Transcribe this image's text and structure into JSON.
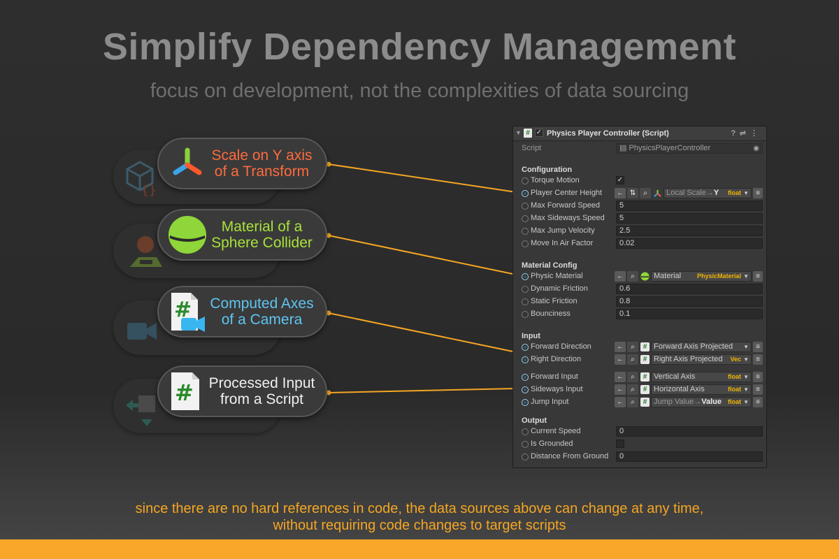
{
  "title": "Simplify Dependency Management",
  "subtitle": "focus on development, not the complexities of data sourcing",
  "footer": {
    "line1": "since there are no hard references in code, the data sources above can change at any time,",
    "line2": "without requiring code changes to target scripts"
  },
  "colors": {
    "accent": "#f9a72a",
    "transform_text": "#ff6b3d",
    "material_text": "#a8e23a",
    "camera_text": "#5fc4f0",
    "script_text": "#f0f0f0",
    "wire": "#f5a623"
  },
  "pills": [
    {
      "icon": "transform-axis-icon",
      "line1": "Scale on Y axis",
      "line2": "of a Transform"
    },
    {
      "icon": "sphere-material-icon",
      "line1": "Material of a",
      "line2": "Sphere Collider"
    },
    {
      "icon": "camera-script-icon",
      "line1": "Computed Axes",
      "line2": "of a Camera"
    },
    {
      "icon": "csharp-script-icon",
      "line1": "Processed Input",
      "line2": "from a Script"
    }
  ],
  "inspector": {
    "header_title": "Physics Player Controller (Script)",
    "script_label": "Script",
    "script_value": "PhysicsPlayerController",
    "sections": {
      "configuration": "Configuration",
      "material_config": "Material Config",
      "input": "Input",
      "output": "Output"
    },
    "config": {
      "torque_motion": "Torque Motion",
      "player_center_height": "Player Center Height",
      "player_center_path": "Local Scale",
      "player_center_member": "Y",
      "player_center_type": "float",
      "max_forward_speed": "Max Forward Speed",
      "max_forward_speed_val": "5",
      "max_sideways_speed": "Max Sideways Speed",
      "max_sideways_speed_val": "5",
      "max_jump_velocity": "Max Jump Velocity",
      "max_jump_velocity_val": "2.5",
      "move_in_air_factor": "Move In Air Factor",
      "move_in_air_factor_val": "0.02"
    },
    "material": {
      "physic_material": "Physic Material",
      "physic_material_src": "Material",
      "physic_material_type": "PhysicMaterial",
      "dynamic_friction": "Dynamic Friction",
      "dynamic_friction_val": "0.6",
      "static_friction": "Static Friction",
      "static_friction_val": "0.8",
      "bounciness": "Bounciness",
      "bounciness_val": "0.1"
    },
    "input": {
      "forward_direction": "Forward Direction",
      "forward_direction_src": "Forward Axis Projected",
      "right_direction": "Right Direction",
      "right_direction_src": "Right Axis Projected",
      "right_direction_type": "Vec",
      "forward_input": "Forward Input",
      "forward_input_src": "Vertical Axis",
      "forward_input_type": "float",
      "sideways_input": "Sideways Input",
      "sideways_input_src": "Horizontal Axis",
      "sideways_input_type": "float",
      "jump_input": "Jump Input",
      "jump_input_path": "Jump Value",
      "jump_input_member": "Value",
      "jump_input_type": "float"
    },
    "output": {
      "current_speed": "Current Speed",
      "current_speed_val": "0",
      "is_grounded": "Is Grounded",
      "distance_from_ground": "Distance From Ground",
      "distance_from_ground_val": "0"
    }
  }
}
